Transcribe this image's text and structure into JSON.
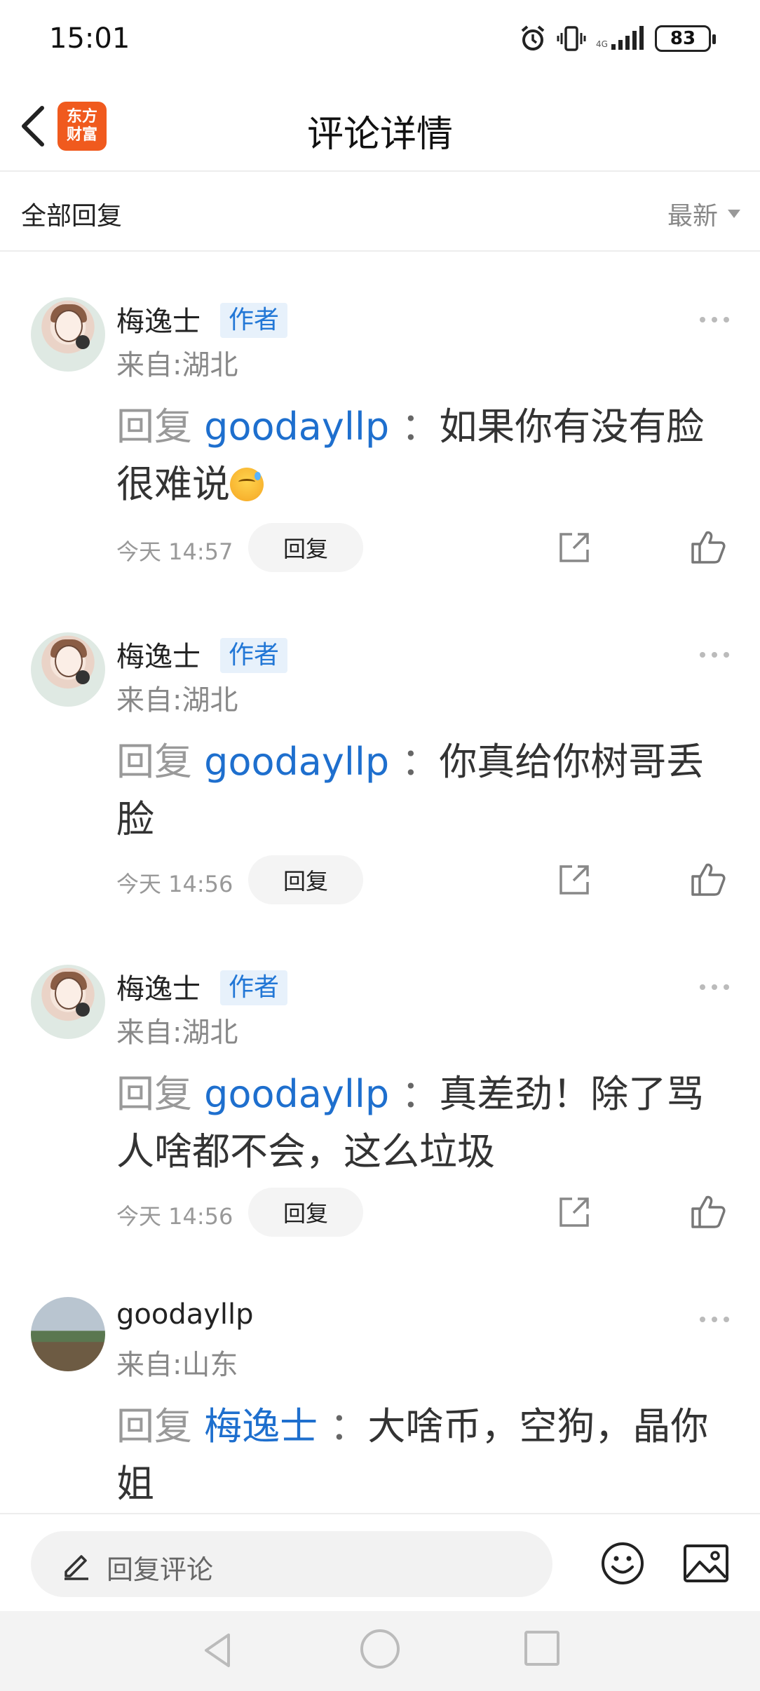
{
  "status_bar": {
    "time": "15:01",
    "battery": "83"
  },
  "header": {
    "logo_line1": "东方",
    "logo_line2": "财富",
    "title": "评论详情"
  },
  "sort_bar": {
    "label": "全部回复",
    "sort": "最新"
  },
  "comments": [
    {
      "username": "梅逸士",
      "badge": "作者",
      "location": "来自:湖北",
      "reply_word": "回复",
      "mention": "goodayllp",
      "separator": "：",
      "text": "如果你有没有脸很难说",
      "emoji": "sweat-face-emoji",
      "time": "今天 14:57",
      "reply_label": "回复"
    },
    {
      "username": "梅逸士",
      "badge": "作者",
      "location": "来自:湖北",
      "reply_word": "回复",
      "mention": "goodayllp",
      "separator": "：",
      "text": "你真给你树哥丢脸",
      "time": "今天 14:56",
      "reply_label": "回复"
    },
    {
      "username": "梅逸士",
      "badge": "作者",
      "location": "来自:湖北",
      "reply_word": "回复",
      "mention": "goodayllp",
      "separator": "：",
      "text": "真差劲！除了骂人啥都不会，这么垃圾",
      "time": "今天 14:56",
      "reply_label": "回复"
    },
    {
      "username": "goodayllp",
      "location": "来自:山东",
      "reply_word": "回复",
      "mention": "梅逸士",
      "separator": "：",
      "text": "大啥币，空狗，晶你姐"
    }
  ],
  "input_bar": {
    "placeholder": "回复评论"
  },
  "colors": {
    "accent_blue": "#1e6fce",
    "logo_orange": "#f05a1e",
    "badge_bg": "#e7f1fb"
  }
}
